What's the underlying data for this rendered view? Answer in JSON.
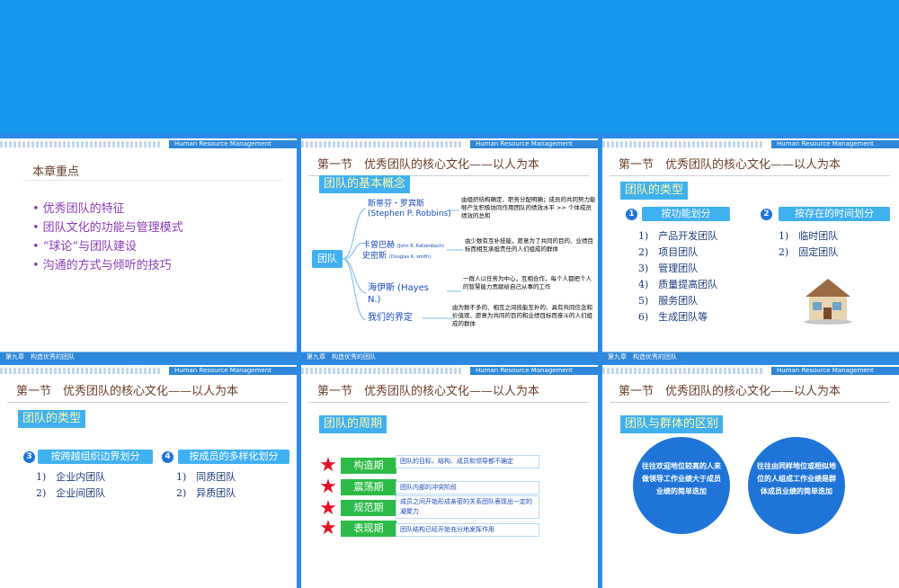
{
  "header_right": "Human Resource Management",
  "footer_label": "第九章　构造优秀的团队",
  "slide1": {
    "title": "本章重点",
    "bullets": [
      "优秀团队的特征",
      "团队文化的功能与管理模式",
      "“球论”与团队建设",
      "沟通的方式与倾听的技巧"
    ]
  },
  "section_title": "第一节　优秀团队的核心文化——以人为本",
  "slide2": {
    "tag": "团队的基本概念",
    "node": "团队",
    "defs": [
      {
        "name": "斯蒂芬・罗宾斯",
        "name_en": "(Stephen P. Robbins)",
        "text": "由组织结构确定、职务分配明确；成员的共同努力能够产生积极协同作用团队的绩效水平 >> 个体成员绩效的总和"
      },
      {
        "name": "卡曾巴赫",
        "name_en": "(John R. Katzenbach)",
        "name2": "史密斯",
        "name2_en": "(Douglas K. smith)",
        "text": "由少数有互补技能，愿意为了共同的目的、业绩目标而相互承担责任的人们组成的群体"
      },
      {
        "name": "海伊斯 (Hayes N.)",
        "text": "一群人以任务为中心，互相合作，每个人都把个人的智慧能力贡献给自己从事的工作"
      },
      {
        "name": "我们的界定",
        "text": "由为数不多的、相互之间技能互补的、具有共同信念和价值观、愿意为共同的目的和业绩目标而奋斗的人们组成的群体"
      }
    ]
  },
  "slide3": {
    "tag": "团队的类型",
    "groups": [
      {
        "num": "1",
        "label": "按功能划分",
        "items": [
          "1)　产品开发团队",
          "2)　项目团队",
          "3)　管理团队",
          "4)　质量提高团队",
          "5)　服务团队",
          "6)　生成团队等"
        ]
      },
      {
        "num": "2",
        "label": "按存在的时间划分",
        "items": [
          "1)　临时团队",
          "2)　固定团队"
        ]
      }
    ]
  },
  "slide4": {
    "tag": "团队的类型",
    "groups": [
      {
        "num": "3",
        "label": "按跨越组织边界划分",
        "items": [
          "1)　企业内团队",
          "2)　企业间团队"
        ]
      },
      {
        "num": "4",
        "label": "按成员的多样化划分",
        "items": [
          "1)　同质团队",
          "2)　异质团队"
        ]
      }
    ]
  },
  "slide5": {
    "tag": "团队的周期",
    "stages": [
      {
        "num": "1",
        "label": "构造期",
        "desc": "团队的目标、结构、成员和领导都不确定"
      },
      {
        "num": "2",
        "label": "震荡期",
        "desc": "团队内部的冲突阶段"
      },
      {
        "num": "3",
        "label": "规范期",
        "desc": "成员之间开始形成亲密的关系团队表现出一定的凝聚力"
      },
      {
        "num": "4",
        "label": "表现期",
        "desc": "团队结构已经开始充分地发挥作用"
      }
    ]
  },
  "slide6": {
    "tag": "团队与群体的区别",
    "circles": [
      "往往欢迎地位较高的人来做领导工作业绩大于成员业绩的简单迭加",
      "往往由同样地位或相似地位的人组成工作业绩是群体成员业绩的简单迭加"
    ]
  }
}
